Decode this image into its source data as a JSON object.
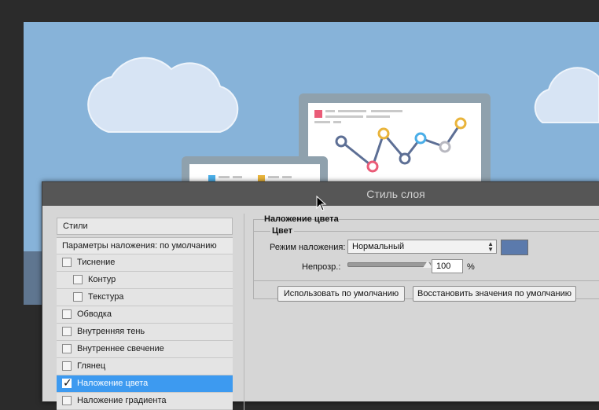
{
  "dialog": {
    "title": "Стиль слоя",
    "styles_header": "Стили",
    "blend_params": "Параметры наложения: по умолчанию",
    "styles": [
      {
        "label": "Тиснение",
        "checked": false,
        "level": 0
      },
      {
        "label": "Контур",
        "checked": false,
        "level": 1
      },
      {
        "label": "Текстура",
        "checked": false,
        "level": 1
      },
      {
        "label": "Обводка",
        "checked": false,
        "level": 0
      },
      {
        "label": "Внутренняя тень",
        "checked": false,
        "level": 0
      },
      {
        "label": "Внутреннее свечение",
        "checked": false,
        "level": 0
      },
      {
        "label": "Глянец",
        "checked": false,
        "level": 0
      },
      {
        "label": "Наложение цвета",
        "checked": true,
        "level": 0,
        "active": true
      },
      {
        "label": "Наложение градиента",
        "checked": false,
        "level": 0
      }
    ],
    "section_title": "Наложение цвета",
    "subsection_title": "Цвет",
    "blend_mode_label": "Режим наложения:",
    "blend_mode_value": "Нормальный",
    "overlay_color": "#5b7aac",
    "opacity_label": "Непрозр.:",
    "opacity_value": "100",
    "opacity_unit": "%",
    "btn_default": "Использовать по умолчанию",
    "btn_restore": "Восстановить значения по умолчанию"
  },
  "colors": {
    "sky": "#87b3d9",
    "accent_blue": "#3d9af0",
    "chart_pink": "#ea5c78",
    "chart_yellow": "#e9b43b",
    "chart_cyan": "#4aaee8",
    "chart_navy": "#5d6f95",
    "chart_gray": "#b8b8c0"
  }
}
